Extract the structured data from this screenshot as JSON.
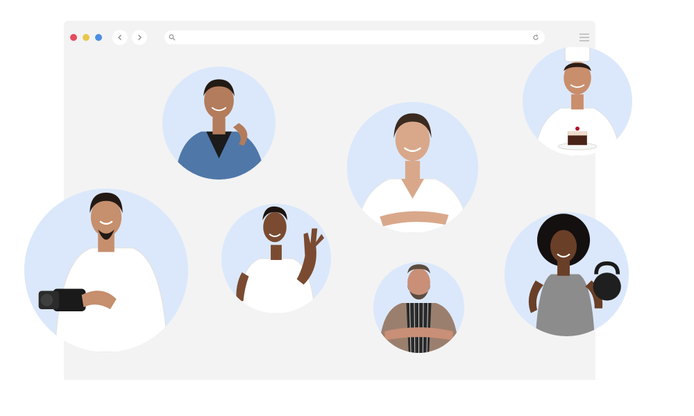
{
  "window": {
    "controls": [
      "close-dot",
      "minimize-dot",
      "maximize-dot"
    ],
    "colors": {
      "close": "#e54b5e",
      "minimize": "#e9c74a",
      "maximize": "#4c8de3",
      "window_bg": "#f3f3f3",
      "avatar_bg": "#dbe8fb"
    },
    "icons": {
      "back": "chevron-left-icon",
      "forward": "chevron-right-icon",
      "search": "search-icon",
      "reload": "reload-icon",
      "menu": "hamburger-menu-icon"
    },
    "url": ""
  },
  "people": [
    {
      "id": "man-denim-jacket",
      "shirt": "#4f77a8",
      "skin": "#b37c5c",
      "hair": "#221a14"
    },
    {
      "id": "woman-white-blouse",
      "shirt": "#ffffff",
      "skin": "#d9a88b",
      "hair": "#3b2a20"
    },
    {
      "id": "chef-with-cake",
      "shirt": "#ffffff",
      "skin": "#c98e6c",
      "hair": "#2b1d16"
    },
    {
      "id": "photographer-with-camera",
      "shirt": "#ffffff",
      "skin": "#c68f6d",
      "hair": "#231914"
    },
    {
      "id": "man-waving",
      "shirt": "#ffffff",
      "skin": "#7a4b31",
      "hair": "#1c140f"
    },
    {
      "id": "man-striped-apron",
      "shirt": "#9b7f6e",
      "skin": "#c98f77",
      "hair": "#5c4c40"
    },
    {
      "id": "woman-kettlebell",
      "shirt": "#8c8c8c",
      "skin": "#6a3f28",
      "hair": "#141010"
    }
  ]
}
